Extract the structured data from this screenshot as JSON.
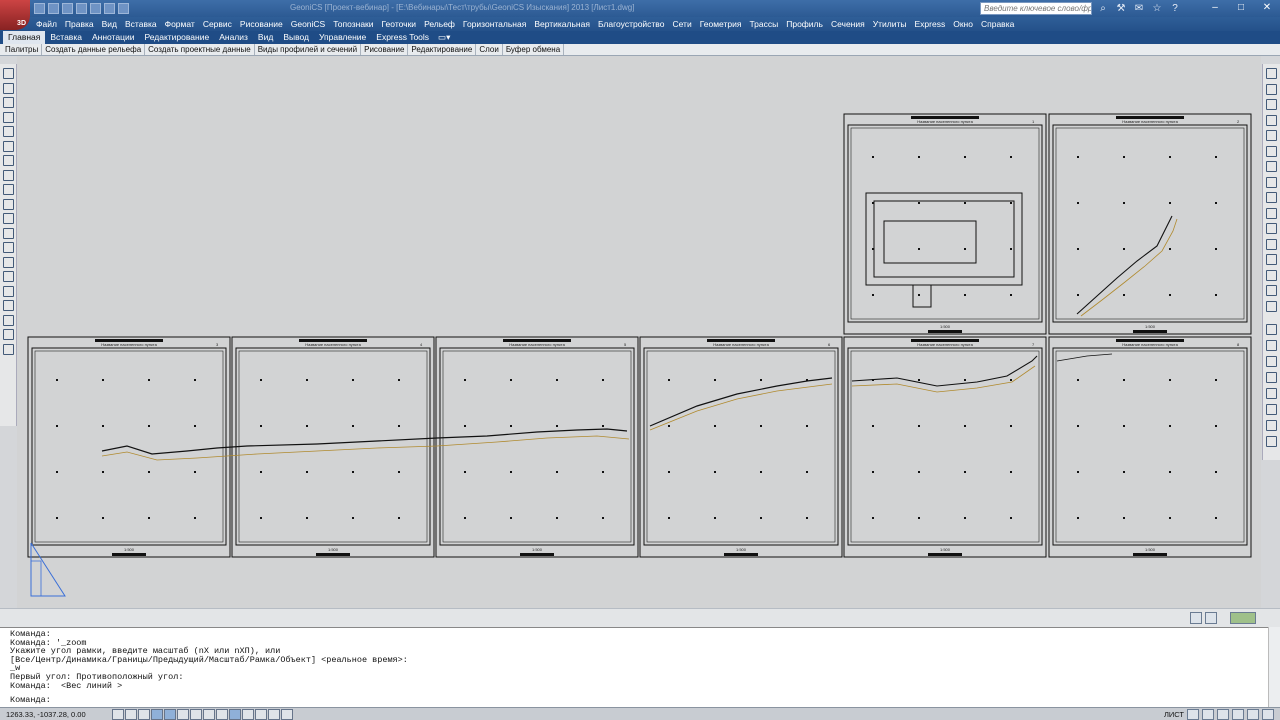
{
  "titlebar": {
    "title": "GeoniCS [Проект-вебинар] - [E:\\Вебинары\\Тест\\трубы\\GeoniCS Изыскания] 2013 [Лист1.dwg]",
    "search_placeholder": "Введите ключевое слово/фразу",
    "app_badge": "3D"
  },
  "menu": [
    "Файл",
    "Правка",
    "Вид",
    "Вставка",
    "Формат",
    "Сервис",
    "Рисование",
    "GeoniCS",
    "Топознаки",
    "Геоточки",
    "Рельеф",
    "Горизонтальная",
    "Вертикальная",
    "Благоустройство",
    "Сети",
    "Геометрия",
    "Трассы",
    "Профиль",
    "Сечения",
    "Утилиты",
    "Express",
    "Окно",
    "Справка"
  ],
  "ribbon_tabs": [
    "Главная",
    "Вставка",
    "Аннотации",
    "Редактирование",
    "Анализ",
    "Вид",
    "Вывод",
    "Управление",
    "Express Tools"
  ],
  "panels": [
    "Палитры",
    "Создать данные рельефа",
    "Создать проектные данные",
    "Виды профилей и сечений",
    "Рисование",
    "Редактирование",
    "Слои",
    "Буфер обмена"
  ],
  "sheets": [
    {
      "num": "1",
      "subtitle": "Название населенного пункта",
      "scale": "1:500"
    },
    {
      "num": "2",
      "subtitle": "Название населенного пункта",
      "scale": "1:500"
    },
    {
      "num": "3",
      "subtitle": "Название населенного пункта",
      "scale": "1:500"
    },
    {
      "num": "4",
      "subtitle": "Название населенного пункта",
      "scale": "1:500"
    },
    {
      "num": "5",
      "subtitle": "Название населенного пункта",
      "scale": "1:500"
    },
    {
      "num": "6",
      "subtitle": "Название населенного пункта",
      "scale": "1:500"
    },
    {
      "num": "7",
      "subtitle": "Название населенного пункта",
      "scale": "1:500"
    },
    {
      "num": "8",
      "subtitle": "Название населенного пункта",
      "scale": "1:500"
    }
  ],
  "command_history": [
    "Команда:",
    "Команда: '_zoom",
    "Укажите угол рамки, введите масштаб (nX или nXП), или",
    "[Все/Центр/Динамика/Границы/Предыдущий/Масштаб/Рамка/Объект] <реальное время>:",
    "_w",
    "Первый угол: Противоположный угол:",
    "Команда:  <Вес линий >"
  ],
  "command_prompt": "Команда:",
  "status": {
    "coords": "1263.33, -1037.28, 0.00",
    "space": "ЛИСТ"
  },
  "colors": {
    "accent": "#2c5a93",
    "ucs": "#3a6fd8",
    "road": "#b08a2e"
  }
}
